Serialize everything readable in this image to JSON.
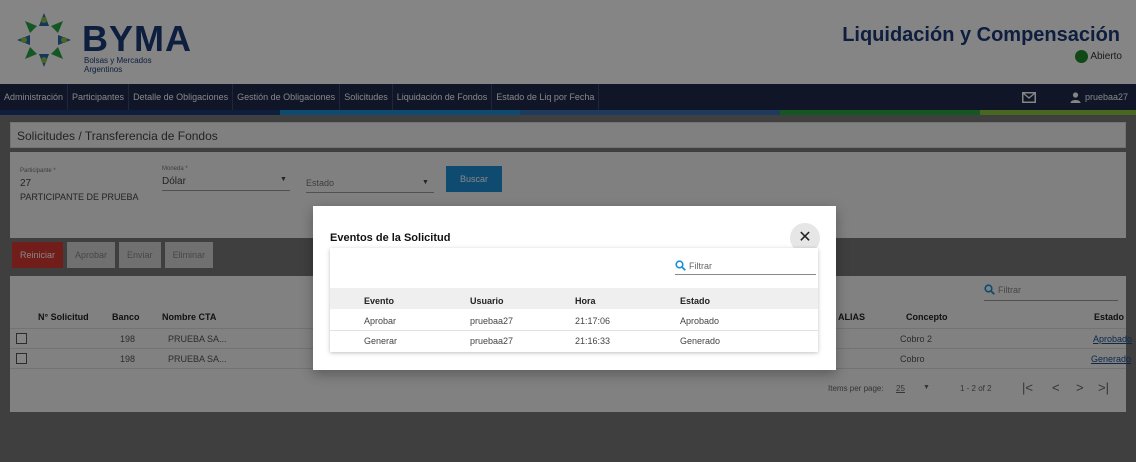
{
  "brand": {
    "name": "BYMA",
    "subtitle": "Bolsas y Mercados Argentinos"
  },
  "header": {
    "title": "Liquidación y Compensación",
    "status": "Abierto",
    "status_color": "#1f8a2b"
  },
  "nav": {
    "items": [
      "Administración",
      "Participantes",
      "Detalle de Obligaciones",
      "Gestión de Obligaciones",
      "Solicitudes",
      "Liquidación de Fondos",
      "Estado de Liq por Fecha"
    ],
    "user": "pruebaa27"
  },
  "breadcrumb": "Solicitudes / Transferencia de Fondos",
  "filters": {
    "participante_label": "Participante *",
    "participante_value": "27",
    "participante_name": "PARTICIPANTE DE PRUEBA",
    "moneda_label": "Moneda *",
    "moneda_value": "Dólar",
    "estado_placeholder": "Estado",
    "buscar_label": "Buscar"
  },
  "actions": [
    "Reiniciar",
    "Aprobar",
    "Enviar",
    "Eliminar"
  ],
  "table": {
    "filter_placeholder": "Filtrar",
    "columns": [
      "N° Solicitud",
      "Banco",
      "Nombre CTA",
      "ALIAS",
      "Concepto",
      "Estado"
    ],
    "rows": [
      {
        "banco": "198",
        "nombre": "PRUEBA SA...",
        "concepto": "Cobro 2",
        "estado": "Aprobado"
      },
      {
        "banco": "198",
        "nombre": "PRUEBA SA...",
        "concepto": "Cobro",
        "estado": "Generado"
      }
    ],
    "pager": {
      "items_label": "Items per page:",
      "page_size": "25",
      "range": "1 - 2 of 2"
    }
  },
  "modal": {
    "title": "Eventos de la Solicitud",
    "filter_placeholder": "Filtrar",
    "columns": [
      "Evento",
      "Usuario",
      "Hora",
      "Estado"
    ],
    "rows": [
      {
        "evento": "Aprobar",
        "usuario": "pruebaa27",
        "hora": "21:17:06",
        "estado": "Aprobado"
      },
      {
        "evento": "Generar",
        "usuario": "pruebaa27",
        "hora": "21:16:33",
        "estado": "Generado"
      }
    ]
  },
  "icons": {
    "mail": "mail-icon",
    "user": "user-icon",
    "search": "search-icon",
    "close": "close-icon",
    "dropdown": "chevron-down-icon"
  },
  "colors": {
    "navbar": "#1f2b4d",
    "accent": "#1e90d6",
    "danger": "#d93a35",
    "brand": "#1b3a7a"
  }
}
